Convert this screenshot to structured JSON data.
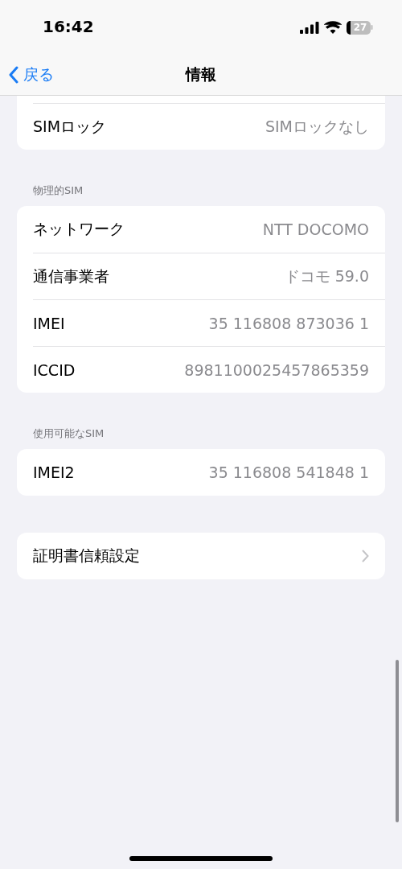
{
  "status_bar": {
    "time": "16:42",
    "battery": "27"
  },
  "nav": {
    "back": "戻る",
    "title": "情報"
  },
  "groups": [
    {
      "continued": true,
      "rows": [
        {
          "kind": "value",
          "label": "SIMロック",
          "value": "SIMロックなし"
        }
      ]
    },
    {
      "header": "物理的SIM",
      "continued": false,
      "rows": [
        {
          "kind": "value",
          "label": "ネットワーク",
          "value": "NTT DOCOMO"
        },
        {
          "kind": "value",
          "label": "通信事業者",
          "value": "ドコモ 59.0"
        },
        {
          "kind": "value",
          "label": "IMEI",
          "value": "35 116808 873036 1"
        },
        {
          "kind": "value",
          "label": "ICCID",
          "value": "8981100025457865359"
        }
      ]
    },
    {
      "header": "使用可能なSIM",
      "continued": false,
      "rows": [
        {
          "kind": "value",
          "label": "IMEI2",
          "value": "35 116808 541848 1"
        }
      ]
    },
    {
      "continued": false,
      "rows": [
        {
          "kind": "link",
          "label": "証明書信頼設定"
        }
      ]
    }
  ]
}
